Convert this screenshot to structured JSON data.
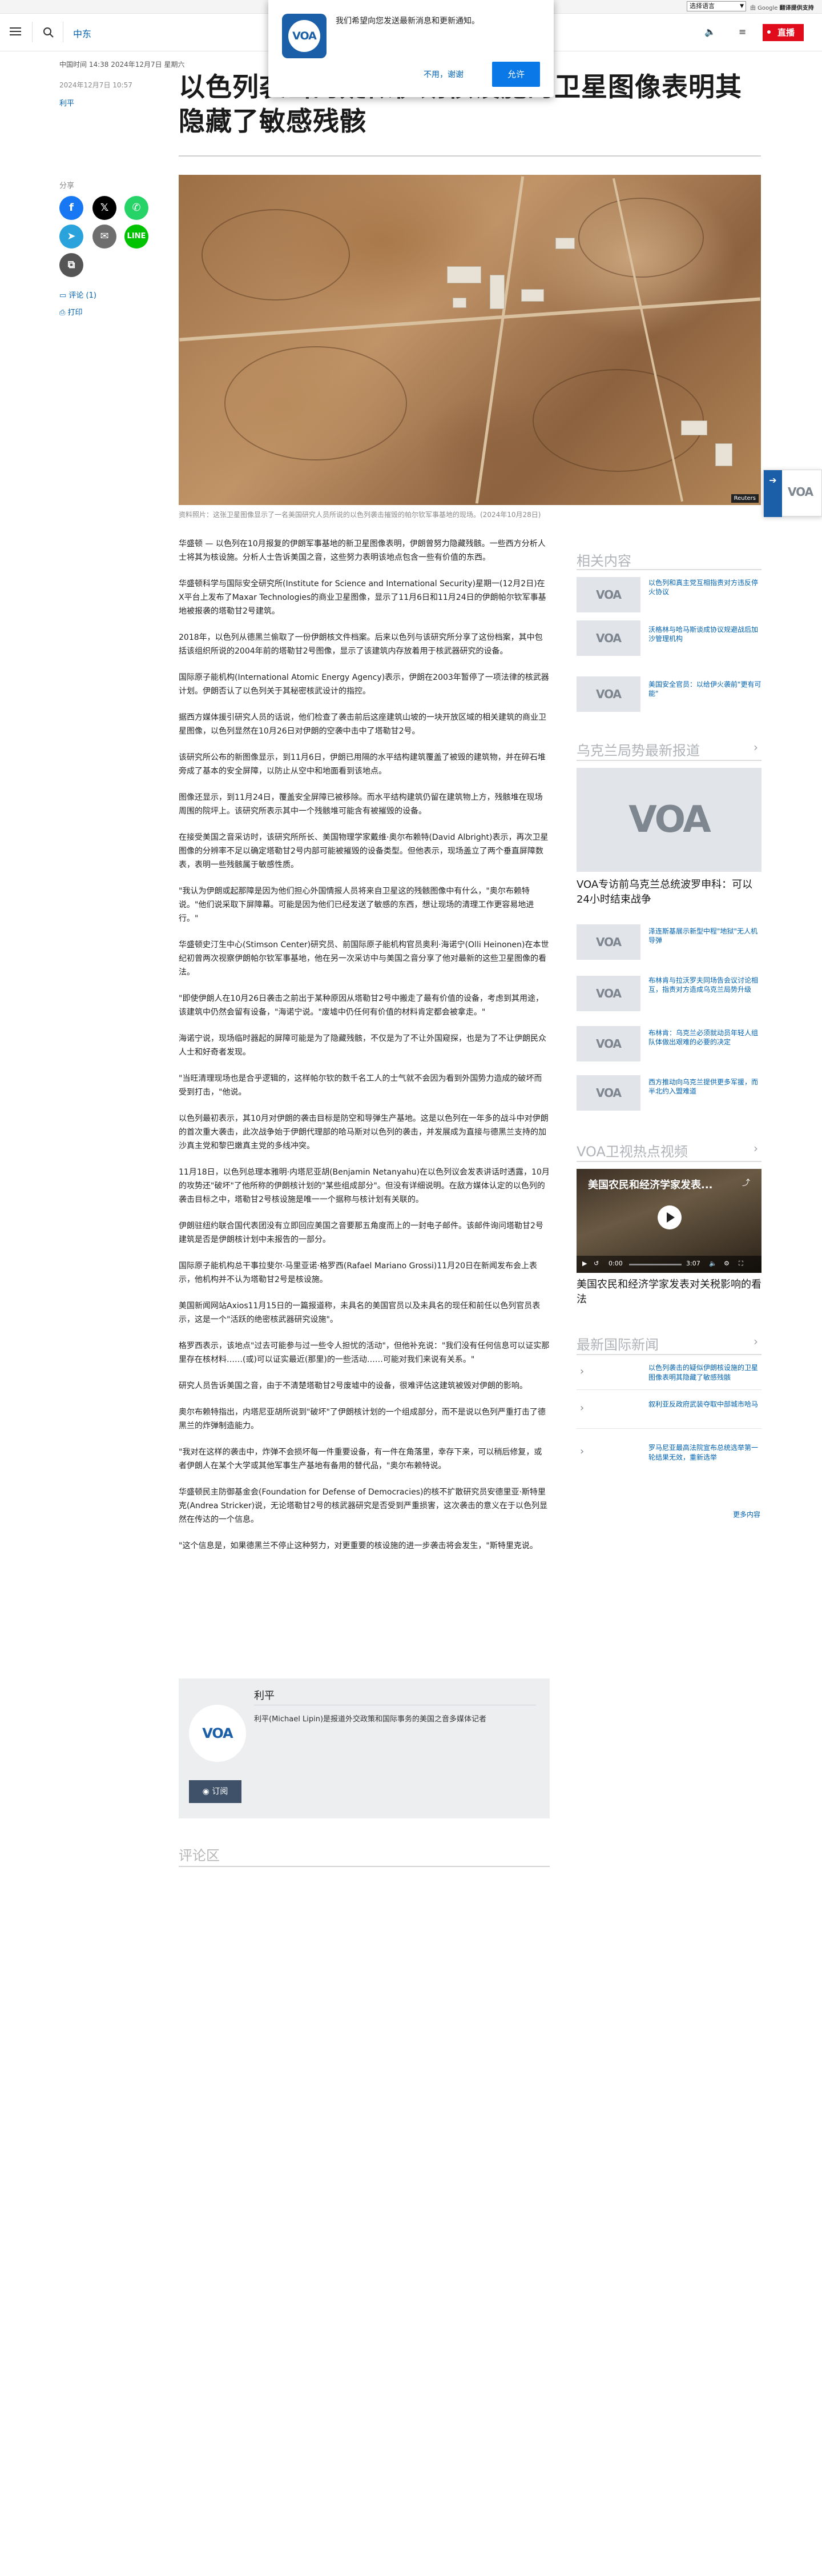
{
  "utility": {
    "language_select": "选择语言",
    "google_prefix": "由 Google",
    "google_suffix": "翻译提供支持"
  },
  "header": {
    "section": "中东",
    "live_label": "直播"
  },
  "notification": {
    "message": "我们希望向您发送最新消息和更新通知。",
    "decline": "不用，谢谢",
    "allow": "允许"
  },
  "article": {
    "dateline": "中国时间 14:38 2024年12月7日 星期六",
    "updated": "2024年12月7日 10:57",
    "author": "利平",
    "headline": "以色列袭击的疑似伊朗核设施的卫星图像表明其隐藏了敏感残骸",
    "share_label": "分享",
    "comments_link": "评论 (1)",
    "print_link": "打印",
    "caption": "资料照片：这张卫星图像显示了一名美国研究人员所说的以色列袭击摧毁的帕尔钦军事基地的现场。(2024年10月28日)",
    "reuters_tag": "Reuters",
    "paragraphs": [
      "华盛顿 — 以色列在10月报复的伊朗军事基地的新卫星图像表明，伊朗曾努力隐藏残骸。一些西方分析人士将其为核设施。分析人士告诉美国之音，这些努力表明该地点包含一些有价值的东西。",
      "华盛顿科学与国际安全研究所(Institute for Science and International Security)星期一(12月2日)在X平台上发布了Maxar Technologies的商业卫星图像，显示了11月6日和11月24日的伊朗帕尔钦军事基地被报袭的塔勒甘2号建筑。",
      "2018年，以色列从德黑兰偷取了一份伊朗核文件档案。后来以色列与该研究所分享了这份档案，其中包括该组织所说的2004年前的塔勒甘2号图像，显示了该建筑内存放着用于核武器研究的设备。",
      "国际原子能机构(International Atomic Energy Agency)表示，伊朗在2003年暂停了一项法律的核武器计划。伊朗否认了以色列关于其秘密核武设计的指控。",
      "据西方媒体援引研究人员的话说，他们检查了袭击前后这座建筑山坡的一块开放区域的相关建筑的商业卫星图像，以色列显然在10月26日对伊朗的空袭中击中了塔勒甘2号。",
      "该研究所公布的新图像显示，到11月6日，伊朗已用隔的水平结构建筑覆盖了被毁的建筑物，并在碎石堆旁成了基本的安全屏障，以防止从空中和地面看到该地点。",
      "图像还显示，到11月24日，覆盖安全屏障已被移除。而水平结构建筑仍留在建筑物上方，残骸堆在现场周围的院坪上。该研究所表示其中一个残骸堆可能含有被摧毁的设备。",
      "在接受美国之音采访时，该研究所所长、美国物理学家戴维·奥尔布赖特(David Albright)表示，再次卫星图像的分辨率不足以确定塔勒甘2号内部可能被摧毁的设备类型。但他表示，现场盖立了两个垂直屏障数表，表明一些残骸属于敏感性质。",
      "\"我认为伊朗或起那障是因为他们担心外国情报人员将来自卫星这的残骸图像中有什么，\"奥尔布赖特说。\"他们说采取下屏障幕。可能是因为他们已经发送了敏感的东西，想让现场的清理工作更容易地进行。\"",
      "华盛顿史汀生中心(Stimson Center)研究员、前国际原子能机构官员奥利·海诺宁(Olli Heinonen)在本世纪初曾两次视察伊朗帕尔钦军事基地，他在另一次采访中与美国之音分享了他对最新的这些卫星图像的看法。",
      "\"即使伊朗人在10月26日袭击之前出于某种原因从塔勒甘2号中搬走了最有价值的设备，考虑到其用途，该建筑中仍然会留有设备，\"海诺宁说。\"废墟中仍任何有价值的材料肯定都会被拿走。\"",
      "海诺宁说，现场临时器起的屏障可能是为了隐藏残骸，不仅是为了不让外国窥探，也是为了不让伊朗民众人士和好奇者发现。",
      "\"当旺清理现场也是合乎逻辑的，这样帕尔钦的数千名工人的士气就不会因为看到外国势力造成的破坏而受到打击，\"他说。",
      "以色列最初表示，其10月对伊朗的袭击目标是防空和导弹生产基地。这是以色列在一年多的战斗中对伊朗的首次重大袭击，此次战争始于伊朗代理部的哈马斯对以色列的袭击，并发展成为直接与德黑兰支持的加沙真主党和黎巴嫩真主党的多线冲突。",
      "11月18日，以色列总理本雅明·内塔尼亚胡(Benjamin Netanyahu)在以色列议会发表讲话时透露，10月的攻势还\"破坏\"了他所称的伊朗核计划的\"某些组成部分\"。但没有详细说明。在敌方媒体认定的以色列的袭击目标之中，塔勒甘2号核设施是唯一一个据称与核计划有关联的。",
      "伊朗驻纽约联合国代表团没有立即回应美国之音要那五角度而上的一封电子邮件。该邮件询问塔勒甘2号建筑是否是伊朗核计划中未报告的一部分。",
      "国际原子能机构总干事拉斐尔·马里亚诺·格罗西(Rafael Mariano Grossi)11月20日在新闻发布会上表示，他机构并不认为塔勒甘2号是核设施。",
      "美国新闻网站Axios11月15日的一篇报道称，未具名的美国官员以及未具名的现任和前任以色列官员表示，这是一个\"活跃的绝密核武器研究设施\"。",
      "格罗西表示，该地点\"过去可能参与过一些令人担忧的活动\"，但他补充说：\"我们没有任何信息可以证实那里存在核材料……(或)可以证实最近(那里)的一些活动……可能对我们来说有关系。\"",
      "研究人员告诉美国之音，由于不清楚塔勒甘2号废墟中的设备，很难评估这建筑被毁对伊朗的影响。",
      "奥尔布赖特指出，内塔尼亚胡所说到\"破坏\"了伊朗核计划的一个组成部分，而不是说以色列严重打击了德黑兰的炸弹制造能力。",
      "\"我对在这样的袭击中，炸弹不会损坏每一件重要设备，有一件在角落里，幸存下来，可以稍后修复，或者伊朗人在某个大学或其他军事生产基地有备用的替代品，\"奥尔布赖特说。",
      "华盛顿民主防御基金会(Foundation for Defense of Democracies)的核不扩散研究员安德里亚·斯特里克(Andrea Stricker)说，无论塔勒甘2号的核武器研究是否受到严重损害，这次袭击的意义在于以色列显然在传达的一个信息。",
      "\"这个信息是，如果德黑兰不停止这种努力，对更重要的核设施的进一步袭击将会发生，\"斯特里克说。"
    ]
  },
  "author_box": {
    "name": "利平",
    "bio": "利平(Michael Lipin)是报道外交政策和国际事务的美国之音多媒体记者",
    "logo": "VOA",
    "subscribe": "订阅"
  },
  "comments": {
    "heading": "评论区"
  },
  "sidebar": {
    "related": {
      "heading": "相关内容",
      "items": [
        {
          "thumb": "VOA",
          "text": "以色列和真主党互相指责对方违反停火协议"
        },
        {
          "thumb": "VOA",
          "text": "沃格林与哈马斯谈成协议规避战后加沙管理机构"
        },
        {
          "thumb": "VOA",
          "text": "美国安全官员：以给伊火袭前\"更有可能\""
        }
      ]
    },
    "ukraine": {
      "heading": "乌克兰局势最新报道",
      "feature_thumb": "VOA",
      "feature_title": "VOA专访前乌克兰总统波罗申科：可以24小时结束战争",
      "items": [
        {
          "thumb": "VOA",
          "text": "泽连斯基展示新型中程\"地狱\"无人机导弹"
        },
        {
          "thumb": "VOA",
          "text": "布林肯与拉沃罗夫同场告会议讨论相互，指责对方造成乌克兰局势升级"
        },
        {
          "thumb": "VOA",
          "text": "布林肯：乌克兰必须就动员年轻人组队体做出艰难的必要的决定"
        },
        {
          "thumb": "VOA",
          "text": "西方推动向乌克兰提供更多军援，而半北约入盟难道"
        }
      ]
    },
    "video": {
      "heading": "VOA卫视热点视频",
      "overlay_title": "美国农民和经济学家发表...",
      "time_current": "0:00",
      "time_total": "3:07",
      "caption": "美国农民和经济学家发表对关税影响的看法"
    },
    "intl": {
      "heading": "最新国际新闻",
      "items": [
        "以色列袭击的疑似伊朗核设施的卫星图像表明其隐藏了敏感残骸",
        "叙利亚反政府武装夺取中部城市哈马",
        "罗马尼亚最高法院宣布总统选举第一轮结果无效，重新选举"
      ],
      "more": "更多内容"
    }
  },
  "float_tab": {
    "logo": "VOA"
  },
  "colors": {
    "brand_blue": "#1b5fa8",
    "link_blue": "#0162b1",
    "live_red": "#e10c1b"
  }
}
